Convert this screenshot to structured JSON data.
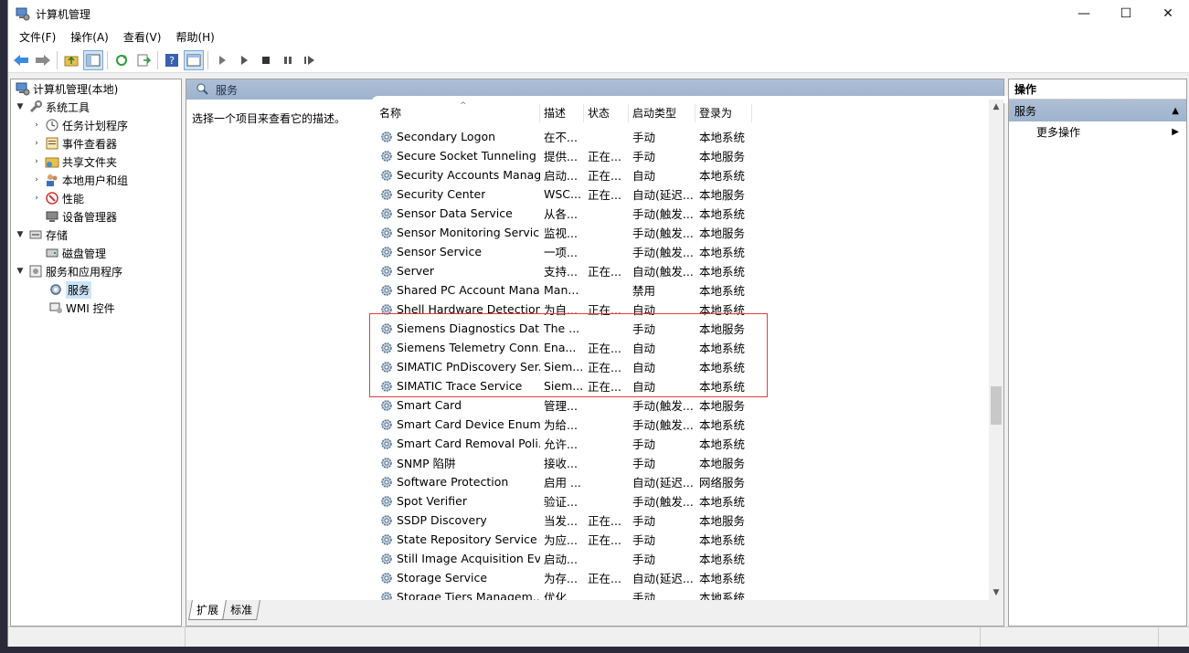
{
  "window": {
    "title": "计算机管理",
    "controls": {
      "minimize": "—",
      "maximize": "☐",
      "close": "✕"
    }
  },
  "menu": [
    "文件(F)",
    "操作(A)",
    "查看(V)",
    "帮助(H)"
  ],
  "tree": {
    "root": "计算机管理(本地)",
    "system_tools": "系统工具",
    "task_scheduler": "任务计划程序",
    "event_viewer": "事件查看器",
    "shared_folders": "共享文件夹",
    "local_users": "本地用户和组",
    "performance": "性能",
    "device_manager": "设备管理器",
    "storage": "存储",
    "disk_management": "磁盘管理",
    "services_apps": "服务和应用程序",
    "services": "服务",
    "wmi": "WMI 控件"
  },
  "center": {
    "header": "服务",
    "description": "选择一个项目来查看它的描述。",
    "columns": {
      "name": "名称",
      "desc": "描述",
      "status": "状态",
      "start": "启动类型",
      "logon": "登录为"
    },
    "sort_indicator": "^",
    "services": [
      {
        "name": "Secondary Logon",
        "desc": "在不...",
        "status": "",
        "start": "手动",
        "logon": "本地系统"
      },
      {
        "name": "Secure Socket Tunneling ...",
        "desc": "提供...",
        "status": "正在...",
        "start": "手动",
        "logon": "本地服务"
      },
      {
        "name": "Security Accounts Manag...",
        "desc": "启动...",
        "status": "正在...",
        "start": "自动",
        "logon": "本地系统"
      },
      {
        "name": "Security Center",
        "desc": "WSC...",
        "status": "正在...",
        "start": "自动(延迟...",
        "logon": "本地服务"
      },
      {
        "name": "Sensor Data Service",
        "desc": "从各...",
        "status": "",
        "start": "手动(触发...",
        "logon": "本地系统"
      },
      {
        "name": "Sensor Monitoring Service",
        "desc": "监视...",
        "status": "",
        "start": "手动(触发...",
        "logon": "本地服务"
      },
      {
        "name": "Sensor Service",
        "desc": "一项...",
        "status": "",
        "start": "手动(触发...",
        "logon": "本地系统"
      },
      {
        "name": "Server",
        "desc": "支持...",
        "status": "正在...",
        "start": "自动(触发...",
        "logon": "本地系统"
      },
      {
        "name": "Shared PC Account Mana...",
        "desc": "Man...",
        "status": "",
        "start": "禁用",
        "logon": "本地系统"
      },
      {
        "name": "Shell Hardware Detection",
        "desc": "为自...",
        "status": "正在...",
        "start": "自动",
        "logon": "本地系统"
      },
      {
        "name": "Siemens Diagnostics Dat...",
        "desc": "The ...",
        "status": "",
        "start": "手动",
        "logon": "本地服务"
      },
      {
        "name": "Siemens Telemetry Conn...",
        "desc": "Ena...",
        "status": "正在...",
        "start": "自动",
        "logon": "本地系统"
      },
      {
        "name": "SIMATIC PnDiscovery Ser...",
        "desc": "Siem...",
        "status": "正在...",
        "start": "自动",
        "logon": "本地系统"
      },
      {
        "name": "SIMATIC Trace Service",
        "desc": "Siem...",
        "status": "正在...",
        "start": "自动",
        "logon": "本地系统"
      },
      {
        "name": "Smart Card",
        "desc": "管理...",
        "status": "",
        "start": "手动(触发...",
        "logon": "本地服务"
      },
      {
        "name": "Smart Card Device Enum...",
        "desc": "为给...",
        "status": "",
        "start": "手动(触发...",
        "logon": "本地系统"
      },
      {
        "name": "Smart Card Removal Poli...",
        "desc": "允许...",
        "status": "",
        "start": "手动",
        "logon": "本地系统"
      },
      {
        "name": "SNMP 陷阱",
        "desc": "接收...",
        "status": "",
        "start": "手动",
        "logon": "本地服务"
      },
      {
        "name": "Software Protection",
        "desc": "启用 ...",
        "status": "",
        "start": "自动(延迟...",
        "logon": "网络服务"
      },
      {
        "name": "Spot Verifier",
        "desc": "验证...",
        "status": "",
        "start": "手动(触发...",
        "logon": "本地系统"
      },
      {
        "name": "SSDP Discovery",
        "desc": "当发...",
        "status": "正在...",
        "start": "手动",
        "logon": "本地服务"
      },
      {
        "name": "State Repository Service",
        "desc": "为应...",
        "status": "正在...",
        "start": "手动",
        "logon": "本地系统"
      },
      {
        "name": "Still Image Acquisition Ev...",
        "desc": "启动...",
        "status": "",
        "start": "手动",
        "logon": "本地系统"
      },
      {
        "name": "Storage Service",
        "desc": "为存...",
        "status": "正在...",
        "start": "自动(延迟...",
        "logon": "本地系统"
      },
      {
        "name": "Storage Tiers Managem...",
        "desc": "优化...",
        "status": "",
        "start": "手动",
        "logon": "本地系统"
      }
    ],
    "tabs": {
      "extended": "扩展",
      "standard": "标准"
    }
  },
  "actions": {
    "title": "操作",
    "section": "服务",
    "section_arrow": "▲",
    "more": "更多操作",
    "more_arrow": "▶"
  },
  "colors": {
    "header_blue": "#9db3ce",
    "highlight_red": "#e04040",
    "selection": "#cce4f7"
  }
}
